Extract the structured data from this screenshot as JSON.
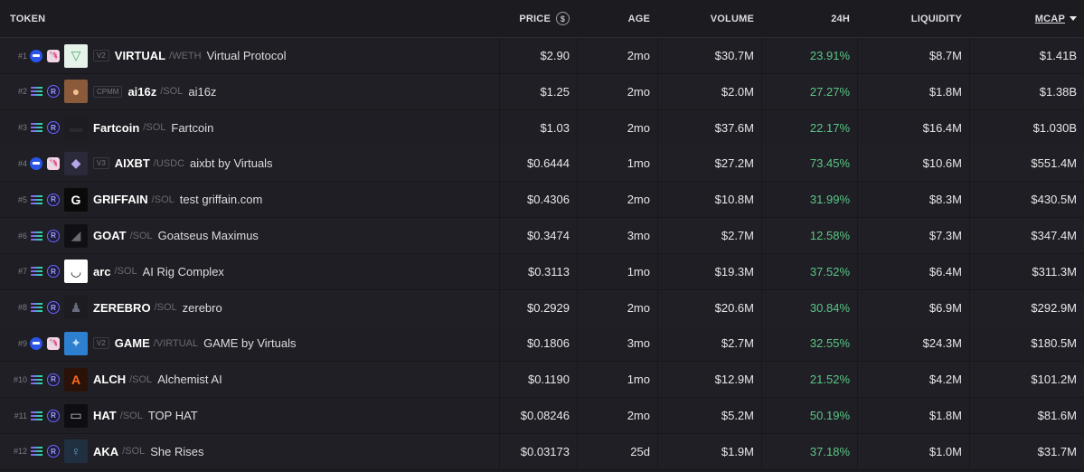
{
  "header": {
    "token": "TOKEN",
    "price": "PRICE",
    "age": "AGE",
    "volume": "VOLUME",
    "change24h": "24H",
    "liquidity": "LIQUIDITY",
    "mcap": "MCAP",
    "price_icon": "dollar-circle-icon",
    "sort_icon": "caret-down-icon"
  },
  "rows": [
    {
      "rank": "#1",
      "chain": "base",
      "dex": "uniswap",
      "avatar": "virtual-logo",
      "version": "V2",
      "symbol": "VIRTUAL",
      "pair": "/WETH",
      "name": "Virtual Protocol",
      "price": "$2.90",
      "age": "2mo",
      "volume": "$30.7M",
      "change": "23.91%",
      "liquidity": "$8.7M",
      "mcap": "$1.41B"
    },
    {
      "rank": "#2",
      "chain": "solana",
      "dex": "raydium",
      "avatar": "ai16z-logo",
      "version": "CPMM",
      "symbol": "ai16z",
      "pair": "/SOL",
      "name": "ai16z",
      "price": "$1.25",
      "age": "2mo",
      "volume": "$2.0M",
      "change": "27.27%",
      "liquidity": "$1.8M",
      "mcap": "$1.38B"
    },
    {
      "rank": "#3",
      "chain": "solana",
      "dex": "raydium",
      "avatar": "fartcoin-logo",
      "version": "",
      "symbol": "Fartcoin",
      "pair": "/SOL",
      "name": "Fartcoin",
      "price": "$1.03",
      "age": "2mo",
      "volume": "$37.6M",
      "change": "22.17%",
      "liquidity": "$16.4M",
      "mcap": "$1.030B"
    },
    {
      "rank": "#4",
      "chain": "base",
      "dex": "uniswap",
      "avatar": "aixbt-logo",
      "version": "V3",
      "symbol": "AIXBT",
      "pair": "/USDC",
      "name": "aixbt by Virtuals",
      "price": "$0.6444",
      "age": "1mo",
      "volume": "$27.2M",
      "change": "73.45%",
      "liquidity": "$10.6M",
      "mcap": "$551.4M"
    },
    {
      "rank": "#5",
      "chain": "solana",
      "dex": "raydium",
      "avatar": "griffain-logo",
      "version": "",
      "symbol": "GRIFFAIN",
      "pair": "/SOL",
      "name": "test griffain.com",
      "price": "$0.4306",
      "age": "2mo",
      "volume": "$10.8M",
      "change": "31.99%",
      "liquidity": "$8.3M",
      "mcap": "$430.5M"
    },
    {
      "rank": "#6",
      "chain": "solana",
      "dex": "raydium",
      "avatar": "goat-logo",
      "version": "",
      "symbol": "GOAT",
      "pair": "/SOL",
      "name": "Goatseus Maximus",
      "price": "$0.3474",
      "age": "3mo",
      "volume": "$2.7M",
      "change": "12.58%",
      "liquidity": "$7.3M",
      "mcap": "$347.4M"
    },
    {
      "rank": "#7",
      "chain": "solana",
      "dex": "raydium",
      "avatar": "arc-logo",
      "version": "",
      "symbol": "arc",
      "pair": "/SOL",
      "name": "AI Rig Complex",
      "price": "$0.3113",
      "age": "1mo",
      "volume": "$19.3M",
      "change": "37.52%",
      "liquidity": "$6.4M",
      "mcap": "$311.3M"
    },
    {
      "rank": "#8",
      "chain": "solana",
      "dex": "raydium",
      "avatar": "zerebro-logo",
      "version": "",
      "symbol": "ZEREBRO",
      "pair": "/SOL",
      "name": "zerebro",
      "price": "$0.2929",
      "age": "2mo",
      "volume": "$20.6M",
      "change": "30.84%",
      "liquidity": "$6.9M",
      "mcap": "$292.9M"
    },
    {
      "rank": "#9",
      "chain": "base",
      "dex": "uniswap",
      "avatar": "game-logo",
      "version": "V2",
      "symbol": "GAME",
      "pair": "/VIRTUAL",
      "name": "GAME by Virtuals",
      "price": "$0.1806",
      "age": "3mo",
      "volume": "$2.7M",
      "change": "32.55%",
      "liquidity": "$24.3M",
      "mcap": "$180.5M"
    },
    {
      "rank": "#10",
      "chain": "solana",
      "dex": "raydium",
      "avatar": "alch-logo",
      "version": "",
      "symbol": "ALCH",
      "pair": "/SOL",
      "name": "Alchemist AI",
      "price": "$0.1190",
      "age": "1mo",
      "volume": "$12.9M",
      "change": "21.52%",
      "liquidity": "$4.2M",
      "mcap": "$101.2M"
    },
    {
      "rank": "#11",
      "chain": "solana",
      "dex": "raydium",
      "avatar": "hat-logo",
      "version": "",
      "symbol": "HAT",
      "pair": "/SOL",
      "name": "TOP HAT",
      "price": "$0.08246",
      "age": "2mo",
      "volume": "$5.2M",
      "change": "50.19%",
      "liquidity": "$1.8M",
      "mcap": "$81.6M"
    },
    {
      "rank": "#12",
      "chain": "solana",
      "dex": "raydium",
      "avatar": "aka-logo",
      "version": "",
      "symbol": "AKA",
      "pair": "/SOL",
      "name": "She Rises",
      "price": "$0.03173",
      "age": "25d",
      "volume": "$1.9M",
      "change": "37.18%",
      "liquidity": "$1.0M",
      "mcap": "$31.7M"
    }
  ],
  "colors": {
    "positive": "#5bc785",
    "background": "#1c1c21",
    "base_chain": "#2a55e8"
  }
}
